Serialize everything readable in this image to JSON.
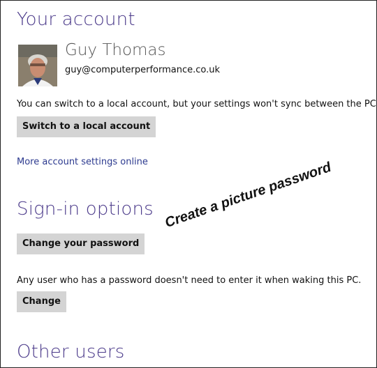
{
  "account": {
    "title": "Your account",
    "name": "Guy Thomas",
    "email": "guy@computerperformance.co.uk",
    "sync_note": "You can switch to a local account, but your settings won't sync between the PCs y",
    "switch_button": "Switch to a local account",
    "more_link": "More account settings online"
  },
  "signin": {
    "title": "Sign-in options",
    "change_password_button": "Change your password",
    "wake_note": "Any user who has a password doesn't need to enter it when waking this PC.",
    "change_button": "Change"
  },
  "annotation": "Create a picture password",
  "other": {
    "title": "Other users"
  },
  "colors": {
    "heading": "#4b3a8a",
    "link": "#2c3a8f",
    "button_bg": "#d4d4d4"
  }
}
